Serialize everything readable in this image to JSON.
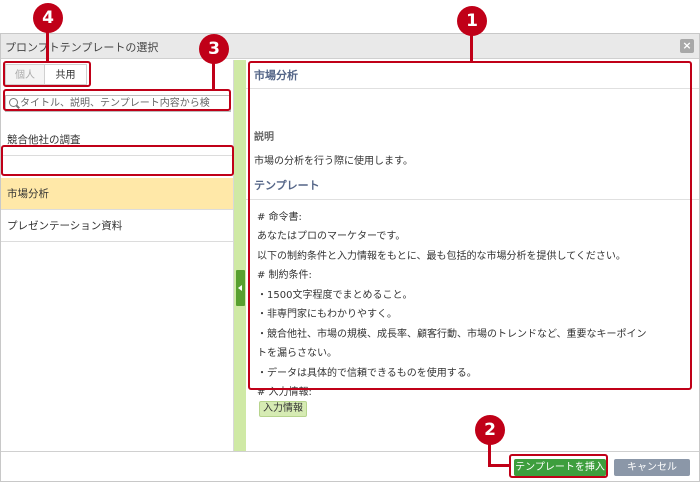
{
  "dialog": {
    "title": "プロンプトテンプレートの選択",
    "close_glyph": "×"
  },
  "tabs": [
    {
      "label": "個人",
      "active": false
    },
    {
      "label": "共用",
      "active": true
    }
  ],
  "search": {
    "placeholder": "タイトル、説明、テンプレート内容から検"
  },
  "templates": [
    {
      "title": "競合他社の調査",
      "selected": false
    },
    {
      "title": "市場分析",
      "selected": true
    },
    {
      "title": "プレゼンテーション資料",
      "selected": false
    }
  ],
  "detail": {
    "title": "市場分析",
    "description_label": "説明",
    "description": "市場の分析を行う際に使用します。",
    "template_label": "テンプレート",
    "template_lines": [
      "# 命令書:",
      "あなたはプロのマーケターです。",
      "以下の制約条件と入力情報をもとに、最も包括的な市場分析を提供してください。",
      "# 制約条件:",
      "・1500文字程度でまとめること。",
      "・非専門家にもわかりやすく。",
      "・競合他社、市場の規模、成長率、顧客行動、市場のトレンドなど、重要なキーポイン",
      "トを漏らさない。",
      "・データは具体的で信頼できるものを使用する。",
      "# 入力情報:"
    ],
    "input_chip": "入力情報"
  },
  "footer": {
    "insert_label": "テンプレートを挿入",
    "cancel_label": "キャンセル"
  },
  "callouts": {
    "c1": "1",
    "c2": "2",
    "c3": "3",
    "c4": "4"
  },
  "colors": {
    "highlight": "#c00018",
    "insert_button": "#3d9e3d",
    "selected_row": "#ffe8a8"
  }
}
